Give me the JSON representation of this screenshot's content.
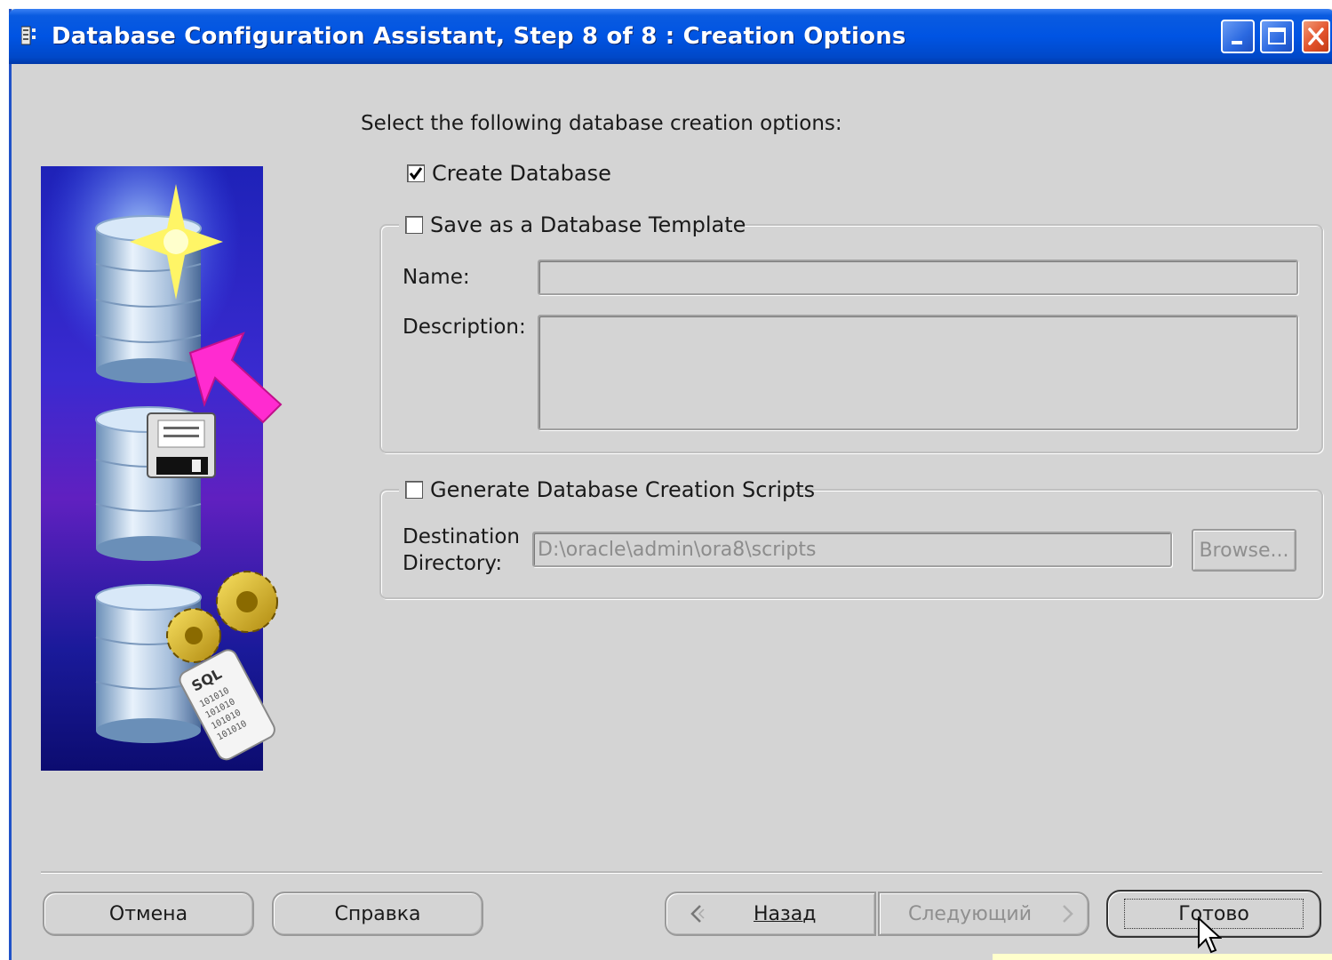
{
  "window": {
    "title": "Database Configuration Assistant, Step 8 of 8 : Creation Options"
  },
  "titlebar_buttons": {
    "minimize_icon": "minimize-icon",
    "maximize_icon": "maximize-icon",
    "close_icon": "close-icon"
  },
  "content": {
    "instruction": "Select the following database creation options:",
    "create_database": {
      "label": "Create Database",
      "checked": true
    },
    "save_template": {
      "label": "Save as a Database Template",
      "checked": false,
      "name_label": "Name:",
      "name_value": "",
      "description_label": "Description:",
      "description_value": ""
    },
    "generate_scripts": {
      "label": "Generate Database Creation Scripts",
      "checked": false,
      "destination_label_line1": "Destination",
      "destination_label_line2": "Directory:",
      "destination_value": "D:\\oracle\\admin\\ora8\\scripts",
      "browse_label": "Browse..."
    }
  },
  "banner": {
    "sql_text": "SQL",
    "binary_text": "101010"
  },
  "footer": {
    "cancel_label": "Отмена",
    "help_label": "Справка",
    "back_label": "Назад",
    "next_label": "Следующий",
    "finish_label": "Готово"
  },
  "colors": {
    "titlebar": "#0054e3",
    "dialog_bg": "#d4d4d4",
    "banner_top": "#1a1aa0",
    "banner_accent": "#ff2bd0"
  }
}
